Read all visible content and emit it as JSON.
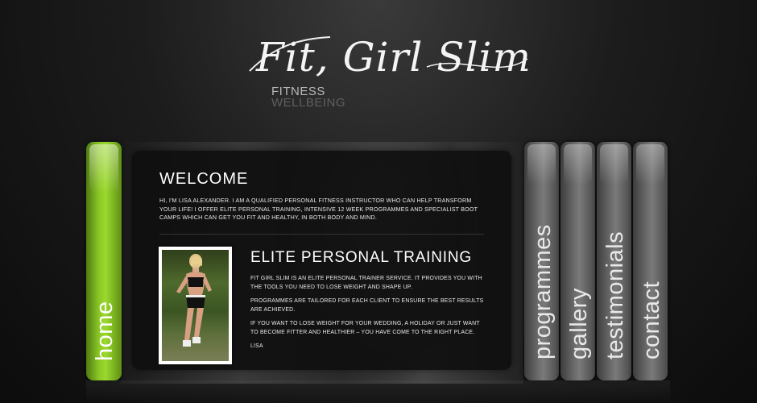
{
  "brand": {
    "logo": "Fit, Girl Slim",
    "tagline_1": "FITNESS",
    "tagline_2": "WELLBEING"
  },
  "nav": {
    "home": "home",
    "programmes": "programmes",
    "gallery": "gallery",
    "testimonials": "testimonials",
    "contact": "contact"
  },
  "welcome": {
    "title": "WELCOME",
    "intro": "HI, I'M LISA ALEXANDER. I AM A QUALIFIED PERSONAL FITNESS INSTRUCTOR WHO CAN HELP TRANSFORM YOUR LIFE! I OFFER ELITE PERSONAL TRAINING, INTENSIVE 12 WEEK PROGRAMMES AND SPECIALIST BOOT CAMPS WHICH CAN GET YOU FIT AND HEALTHY, IN BOTH BODY AND MIND."
  },
  "elite": {
    "title": "ELITE PERSONAL TRAINING",
    "para1": "FIT GIRL SLIM IS AN ELITE PERSONAL TRAINER SERVICE. IT PROVIDES YOU WITH THE TOOLS YOU NEED TO LOSE WEIGHT AND SHAPE UP.",
    "para2": "PROGRAMMES ARE TAILORED FOR EACH CLIENT TO ENSURE THE BEST RESULTS ARE ACHIEVED.",
    "para3": "IF YOU WANT TO LOSE WEIGHT FOR YOUR WEDDING, A HOLIDAY OR JUST WANT TO BECOME FITTER AND HEALTHIER – YOU HAVE COME TO THE RIGHT PLACE.",
    "signoff": "LISA"
  },
  "colors": {
    "accent_green": "#8ac625",
    "tab_grey": "#6b6b6b",
    "background": "#1c1c1c"
  }
}
